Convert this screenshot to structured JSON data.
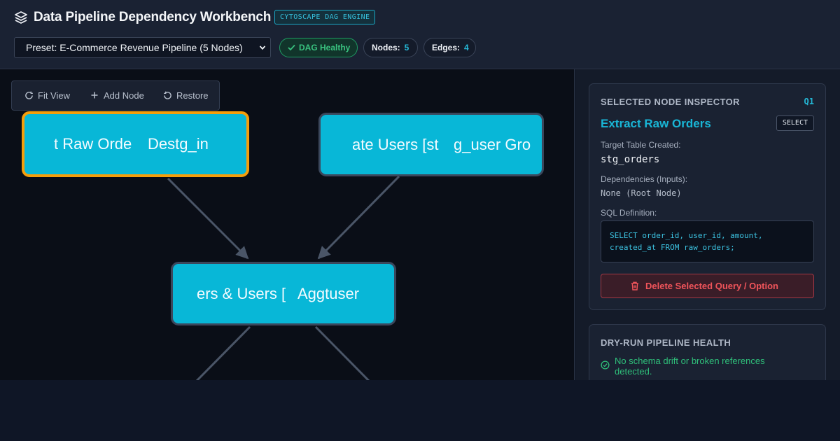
{
  "header": {
    "title": "Data Pipeline Dependency Workbench",
    "engine_tag": "CYTOSCAPE DAG ENGINE",
    "brand_icon": "layers-icon",
    "preset_select": {
      "selected": "Preset: E-Commerce Revenue Pipeline (5 Nodes)"
    },
    "health_pill": "DAG Healthy",
    "nodes_label": "Nodes:",
    "nodes_value": "5",
    "edges_label": "Edges:",
    "edges_value": "4"
  },
  "toolbar": {
    "fit_view": "Fit View",
    "add_node": "Add Node",
    "restore": "Restore"
  },
  "graph": {
    "nodes": [
      {
        "id": "q1",
        "label": "t Raw Orde",
        "overlay": "Destg_in",
        "selected": true
      },
      {
        "id": "q2",
        "label": "ate Users [st",
        "overlay": "g_user Gro",
        "selected": false
      },
      {
        "id": "q3",
        "label": "ers & Users [",
        "overlay": "Aggtuser",
        "selected": false
      }
    ]
  },
  "inspector": {
    "heading": "SELECTED NODE INSPECTOR",
    "query_id": "Q1",
    "node_title": "Extract Raw Orders",
    "kind": "SELECT",
    "target_label": "Target Table Created:",
    "target_value": "stg_orders",
    "deps_label": "Dependencies (Inputs):",
    "deps_value": "None (Root Node)",
    "sql_label": "SQL Definition:",
    "sql_code": "SELECT order_id, user_id, amount,\ncreated_at FROM raw_orders;",
    "delete_button": "Delete Selected Query / Option"
  },
  "health": {
    "heading": "DRY-RUN PIPELINE HEALTH",
    "message": "No schema drift or broken references detected."
  },
  "colors": {
    "accent": "#08b7d7",
    "selected_border": "#f59e0b",
    "healthy": "#39c27f",
    "danger": "#f0545a"
  }
}
